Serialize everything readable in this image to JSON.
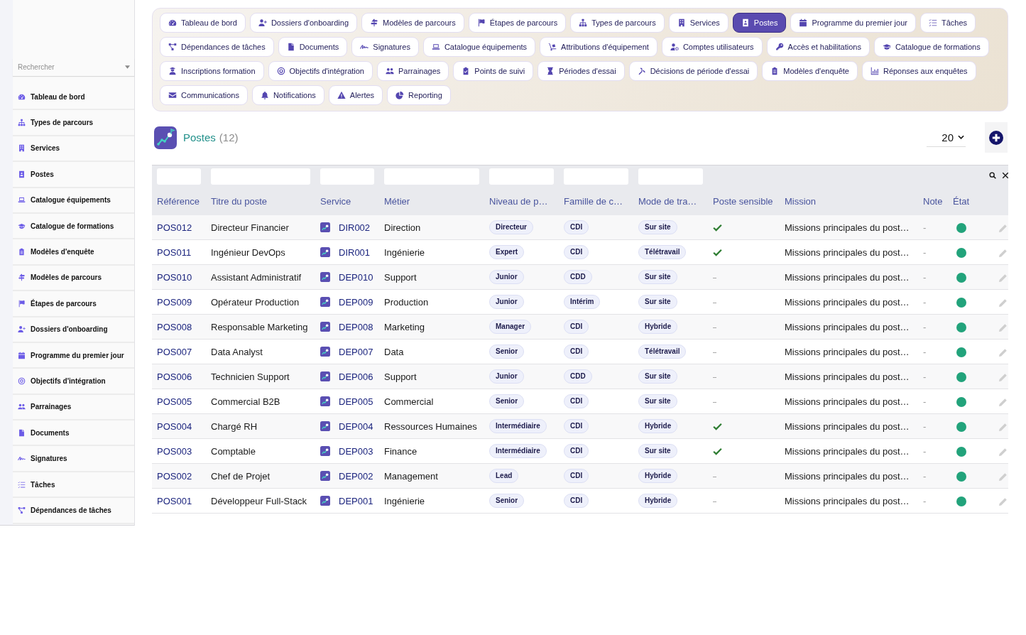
{
  "sidebar": {
    "search": {
      "placeholder": "Rechercher"
    },
    "items": [
      {
        "label": "Tableau de bord",
        "selected": false
      },
      {
        "label": "Types de parcours",
        "selected": false
      },
      {
        "label": "Services",
        "selected": false
      },
      {
        "label": "Postes",
        "selected": false
      },
      {
        "label": "Catalogue équipements",
        "selected": false
      },
      {
        "label": "Catalogue de formations",
        "selected": false
      },
      {
        "label": "Modèles d'enquête",
        "selected": false
      },
      {
        "label": "Modèles de parcours",
        "selected": false
      },
      {
        "label": "Étapes de parcours",
        "selected": false
      },
      {
        "label": "Dossiers d'onboarding",
        "selected": false
      },
      {
        "label": "Programme du premier jour",
        "selected": false
      },
      {
        "label": "Objectifs d'intégration",
        "selected": false
      },
      {
        "label": "Parrainages",
        "selected": false
      },
      {
        "label": "Documents",
        "selected": false
      },
      {
        "label": "Signatures",
        "selected": false
      },
      {
        "label": "Tâches",
        "selected": false
      },
      {
        "label": "Dépendances de tâches",
        "selected": false
      }
    ]
  },
  "nav": {
    "items": [
      {
        "label": "Tableau de bord",
        "selected": false
      },
      {
        "label": "Dossiers d'onboarding",
        "selected": false
      },
      {
        "label": "Modèles de parcours",
        "selected": false
      },
      {
        "label": "Étapes de parcours",
        "selected": false
      },
      {
        "label": "Types de parcours",
        "selected": false
      },
      {
        "label": "Services",
        "selected": false
      },
      {
        "label": "Postes",
        "selected": true
      },
      {
        "label": "Programme du premier jour",
        "selected": false
      },
      {
        "label": "Tâches",
        "selected": false
      },
      {
        "label": "Dépendances de tâches",
        "selected": false
      },
      {
        "label": "Documents",
        "selected": false
      },
      {
        "label": "Signatures",
        "selected": false
      },
      {
        "label": "Catalogue équipements",
        "selected": false
      },
      {
        "label": "Attributions d'équipement",
        "selected": false
      },
      {
        "label": "Comptes utilisateurs",
        "selected": false
      },
      {
        "label": "Accès et habilitations",
        "selected": false
      },
      {
        "label": "Catalogue de formations",
        "selected": false
      },
      {
        "label": "Inscriptions formation",
        "selected": false
      },
      {
        "label": "Objectifs d'intégration",
        "selected": false
      },
      {
        "label": "Parrainages",
        "selected": false
      },
      {
        "label": "Points de suivi",
        "selected": false
      },
      {
        "label": "Périodes d'essai",
        "selected": false
      },
      {
        "label": "Décisions de période d'essai",
        "selected": false
      },
      {
        "label": "Modèles d'enquête",
        "selected": false
      },
      {
        "label": "Réponses aux enquêtes",
        "selected": false
      },
      {
        "label": "Communications",
        "selected": false
      },
      {
        "label": "Notifications",
        "selected": false
      },
      {
        "label": "Alertes",
        "selected": false
      },
      {
        "label": "Reporting",
        "selected": false
      }
    ]
  },
  "page": {
    "title": "Postes",
    "count": "(12)",
    "page_size": "20"
  },
  "table": {
    "columns": [
      {
        "label": "Référence",
        "filter": true
      },
      {
        "label": "Titre du poste",
        "filter": true
      },
      {
        "label": "Service",
        "filter": true
      },
      {
        "label": "Métier",
        "filter": true
      },
      {
        "label": "Niveau de p…",
        "filter": true
      },
      {
        "label": "Famille de c…",
        "filter": true
      },
      {
        "label": "Mode de tra…",
        "filter": true
      },
      {
        "label": "Poste sensible",
        "filter": false
      },
      {
        "label": "Mission",
        "filter": false
      },
      {
        "label": "Note",
        "filter": false
      },
      {
        "label": "État",
        "filter": false
      }
    ],
    "rows": [
      {
        "reference": "POS012",
        "title": "Directeur Financier",
        "service": "DIR002",
        "trade": "Direction",
        "seniority": "Directeur",
        "contract": "CDI",
        "work_mode": "Sur site",
        "sensitive": true,
        "mission": "Missions principales du post…",
        "note": "-",
        "active": true
      },
      {
        "reference": "POS011",
        "title": "Ingénieur DevOps",
        "service": "DIR001",
        "trade": "Ingénierie",
        "seniority": "Expert",
        "contract": "CDI",
        "work_mode": "Télétravail",
        "sensitive": true,
        "mission": "Missions principales du post…",
        "note": "-",
        "active": true
      },
      {
        "reference": "POS010",
        "title": "Assistant Administratif",
        "service": "DEP010",
        "trade": "Support",
        "seniority": "Junior",
        "contract": "CDD",
        "work_mode": "Sur site",
        "sensitive": false,
        "mission": "Missions principales du post…",
        "note": "-",
        "active": true
      },
      {
        "reference": "POS009",
        "title": "Opérateur Production",
        "service": "DEP009",
        "trade": "Production",
        "seniority": "Junior",
        "contract": "Intérim",
        "work_mode": "Sur site",
        "sensitive": false,
        "mission": "Missions principales du post…",
        "note": "-",
        "active": true
      },
      {
        "reference": "POS008",
        "title": "Responsable Marketing",
        "service": "DEP008",
        "trade": "Marketing",
        "seniority": "Manager",
        "contract": "CDI",
        "work_mode": "Hybride",
        "sensitive": false,
        "mission": "Missions principales du post…",
        "note": "-",
        "active": true
      },
      {
        "reference": "POS007",
        "title": "Data Analyst",
        "service": "DEP007",
        "trade": "Data",
        "seniority": "Senior",
        "contract": "CDI",
        "work_mode": "Télétravail",
        "sensitive": false,
        "mission": "Missions principales du post…",
        "note": "-",
        "active": true
      },
      {
        "reference": "POS006",
        "title": "Technicien Support",
        "service": "DEP006",
        "trade": "Support",
        "seniority": "Junior",
        "contract": "CDD",
        "work_mode": "Sur site",
        "sensitive": false,
        "mission": "Missions principales du post…",
        "note": "-",
        "active": true
      },
      {
        "reference": "POS005",
        "title": "Commercial B2B",
        "service": "DEP005",
        "trade": "Commercial",
        "seniority": "Senior",
        "contract": "CDI",
        "work_mode": "Sur site",
        "sensitive": false,
        "mission": "Missions principales du post…",
        "note": "-",
        "active": true
      },
      {
        "reference": "POS004",
        "title": "Chargé RH",
        "service": "DEP004",
        "trade": "Ressources Humaines",
        "seniority": "Intermédiaire",
        "contract": "CDI",
        "work_mode": "Hybride",
        "sensitive": true,
        "mission": "Missions principales du post…",
        "note": "-",
        "active": true
      },
      {
        "reference": "POS003",
        "title": "Comptable",
        "service": "DEP003",
        "trade": "Finance",
        "seniority": "Intermédiaire",
        "contract": "CDI",
        "work_mode": "Sur site",
        "sensitive": true,
        "mission": "Missions principales du post…",
        "note": "-",
        "active": true
      },
      {
        "reference": "POS002",
        "title": "Chef de Projet",
        "service": "DEP002",
        "trade": "Management",
        "seniority": "Lead",
        "contract": "CDI",
        "work_mode": "Hybride",
        "sensitive": false,
        "mission": "Missions principales du post…",
        "note": "-",
        "active": true
      },
      {
        "reference": "POS001",
        "title": "Développeur Full-Stack",
        "service": "DEP001",
        "trade": "Ingénierie",
        "seniority": "Senior",
        "contract": "CDI",
        "work_mode": "Hybride",
        "sensitive": false,
        "mission": "Missions principales du post…",
        "note": "-",
        "active": true
      }
    ]
  }
}
